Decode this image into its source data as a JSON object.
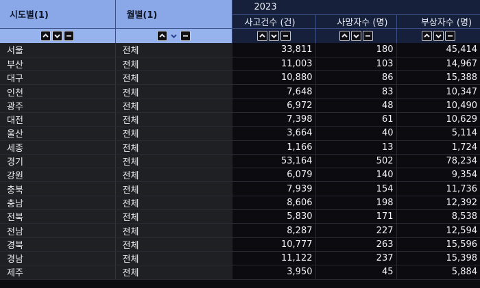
{
  "headers": {
    "sido": "시도별(1)",
    "month": "월별(1)",
    "year": "2023",
    "accidents": "사고건수 (건)",
    "deaths": "사망자수 (명)",
    "injuries": "부상자수 (명)"
  },
  "rows": [
    {
      "sido": "서울",
      "month": "전체",
      "accidents": "33,811",
      "deaths": "180",
      "injuries": "45,414"
    },
    {
      "sido": "부산",
      "month": "전체",
      "accidents": "11,003",
      "deaths": "103",
      "injuries": "14,967"
    },
    {
      "sido": "대구",
      "month": "전체",
      "accidents": "10,880",
      "deaths": "86",
      "injuries": "15,388"
    },
    {
      "sido": "인천",
      "month": "전체",
      "accidents": "7,648",
      "deaths": "83",
      "injuries": "10,347"
    },
    {
      "sido": "광주",
      "month": "전체",
      "accidents": "6,972",
      "deaths": "48",
      "injuries": "10,490"
    },
    {
      "sido": "대전",
      "month": "전체",
      "accidents": "7,398",
      "deaths": "61",
      "injuries": "10,629"
    },
    {
      "sido": "울산",
      "month": "전체",
      "accidents": "3,664",
      "deaths": "40",
      "injuries": "5,114"
    },
    {
      "sido": "세종",
      "month": "전체",
      "accidents": "1,166",
      "deaths": "13",
      "injuries": "1,724"
    },
    {
      "sido": "경기",
      "month": "전체",
      "accidents": "53,164",
      "deaths": "502",
      "injuries": "78,234"
    },
    {
      "sido": "강원",
      "month": "전체",
      "accidents": "6,079",
      "deaths": "140",
      "injuries": "9,354"
    },
    {
      "sido": "충북",
      "month": "전체",
      "accidents": "7,939",
      "deaths": "154",
      "injuries": "11,736"
    },
    {
      "sido": "충남",
      "month": "전체",
      "accidents": "8,606",
      "deaths": "198",
      "injuries": "12,392"
    },
    {
      "sido": "전북",
      "month": "전체",
      "accidents": "5,830",
      "deaths": "171",
      "injuries": "8,538"
    },
    {
      "sido": "전남",
      "month": "전체",
      "accidents": "8,287",
      "deaths": "227",
      "injuries": "12,594"
    },
    {
      "sido": "경북",
      "month": "전체",
      "accidents": "10,777",
      "deaths": "263",
      "injuries": "15,596"
    },
    {
      "sido": "경남",
      "month": "전체",
      "accidents": "11,122",
      "deaths": "237",
      "injuries": "15,398"
    },
    {
      "sido": "제주",
      "month": "전체",
      "accidents": "3,950",
      "deaths": "45",
      "injuries": "5,884"
    }
  ],
  "icons": {
    "sort_asc": "caret-up-icon",
    "sort_desc": "caret-down-icon",
    "remove": "minus-icon"
  },
  "colors": {
    "header_light": "#8aa8e8",
    "header_dark": "#17203a",
    "row_label_bg": "#1f2024",
    "row_value_bg": "#0b0b10"
  }
}
